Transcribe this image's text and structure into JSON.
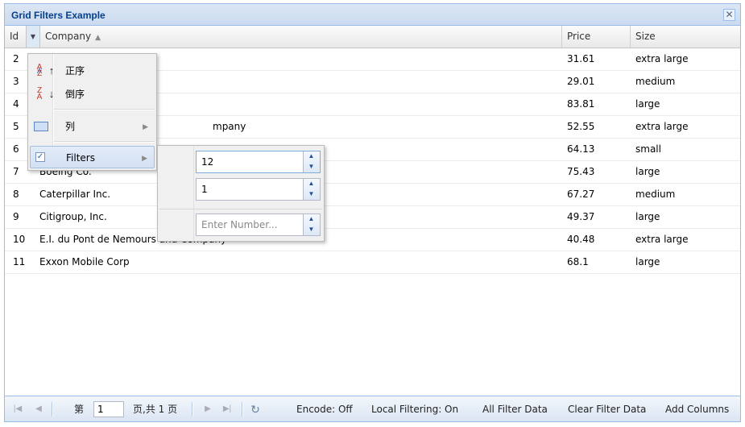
{
  "panel": {
    "title": "Grid Filters Example",
    "close_icon": "close-icon"
  },
  "columns": {
    "id": "Id",
    "company": "Company",
    "price": "Price",
    "size": "Size",
    "company_sort": "▲"
  },
  "rows": [
    {
      "id": "2",
      "company": "",
      "price": "31.61",
      "size": "extra large"
    },
    {
      "id": "3",
      "company": "",
      "price": "29.01",
      "size": "medium"
    },
    {
      "id": "4",
      "company": "",
      "price": "83.81",
      "size": "large"
    },
    {
      "id": "5",
      "company": "mpany",
      "price": "52.55",
      "size": "extra large"
    },
    {
      "id": "6",
      "company": "",
      "price": "64.13",
      "size": "small"
    },
    {
      "id": "7",
      "company": "Boeing Co.",
      "price": "75.43",
      "size": "large"
    },
    {
      "id": "8",
      "company": "Caterpillar Inc.",
      "price": "67.27",
      "size": "medium"
    },
    {
      "id": "9",
      "company": "Citigroup, Inc.",
      "price": "49.37",
      "size": "large"
    },
    {
      "id": "10",
      "company": "E.I. du Pont de Nemours and Company",
      "price": "40.48",
      "size": "extra large"
    },
    {
      "id": "11",
      "company": "Exxon Mobile Corp",
      "price": "68.1",
      "size": "large"
    }
  ],
  "column_menu": {
    "sort_asc": "正序",
    "sort_desc": "倒序",
    "columns": "列",
    "filters": "Filters",
    "filters_checked": true
  },
  "filter_menu": {
    "gt_value": "12",
    "lt_value": "1",
    "eq_value": "",
    "eq_placeholder": "Enter Number..."
  },
  "toolbar": {
    "page_prefix": "第",
    "page_value": "1",
    "page_suffix": "页,共 1 页",
    "encode": "Encode: Off",
    "local_filtering": "Local Filtering: On",
    "all_filter_data": "All Filter Data",
    "clear_filter_data": "Clear Filter Data",
    "add_columns": "Add Columns"
  },
  "colors": {
    "accent": "#99bce8",
    "title": "#04408c"
  }
}
